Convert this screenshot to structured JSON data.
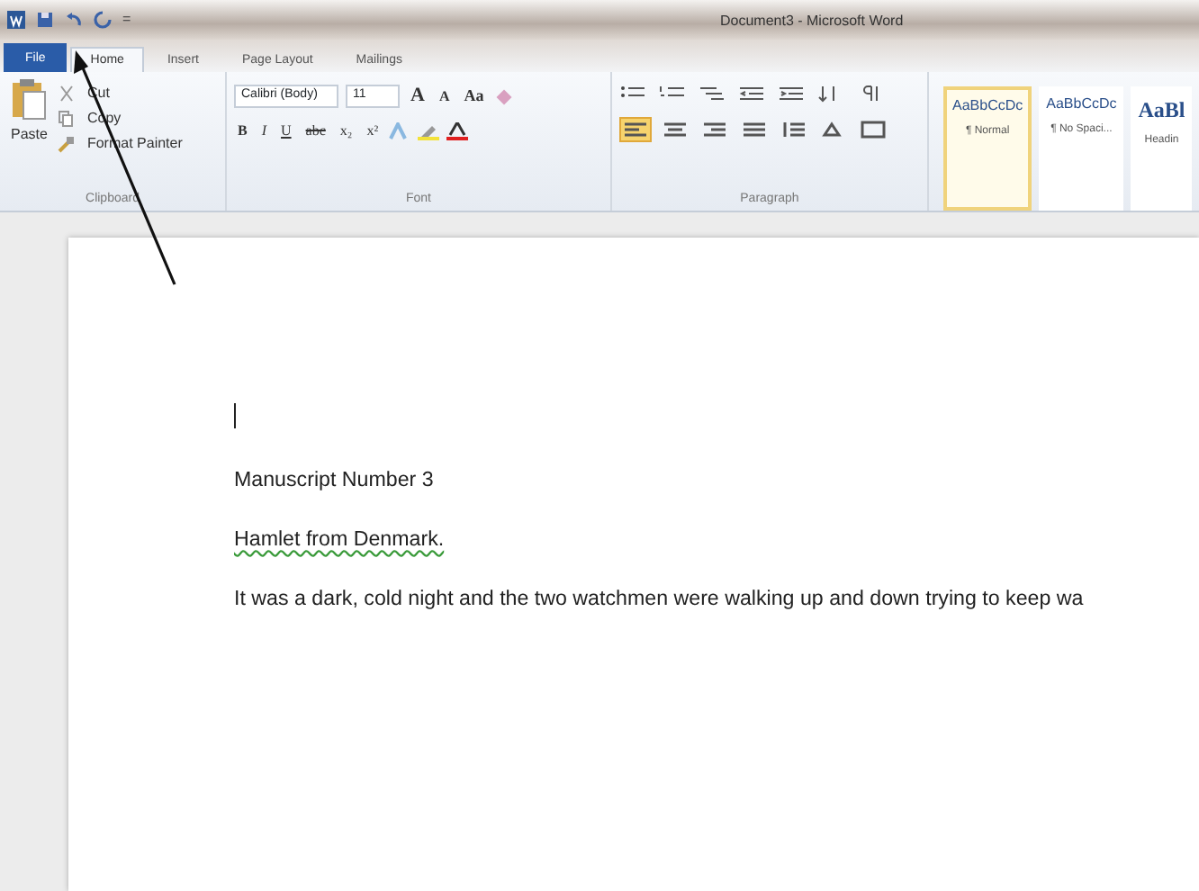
{
  "window": {
    "title": "Document3 - Microsoft Word",
    "quick_access": [
      "="
    ]
  },
  "tabs": [
    {
      "label": "File",
      "kind": "file",
      "selected": false
    },
    {
      "label": "Home",
      "kind": "tab",
      "selected": true
    },
    {
      "label": "Insert",
      "kind": "tab",
      "selected": false
    },
    {
      "label": "Page Layout",
      "kind": "tab",
      "selected": false
    },
    {
      "label": "Mailings",
      "kind": "tab",
      "selected": false
    }
  ],
  "clipboard": {
    "label": "Clipboard",
    "paste": "Paste",
    "items": [
      "Cut",
      "Copy",
      "Format Painter"
    ]
  },
  "font": {
    "label": "Font",
    "font_name": "Calibri (Body)",
    "font_size": "11",
    "row1": [
      "A",
      "A",
      "Aa"
    ],
    "row2": [
      "B",
      "I",
      "U",
      "abc",
      "x₂",
      "x²"
    ]
  },
  "paragraph": {
    "label": "Paragraph",
    "row2": [
      {
        "selected": true
      },
      {
        "selected": false
      },
      {
        "selected": false
      },
      {
        "selected": false
      },
      {
        "selected": false
      },
      {
        "selected": false
      },
      {
        "selected": false
      }
    ]
  },
  "styles": [
    {
      "sample": "AaBbCcDc",
      "name": "¶ Normal",
      "selected": true
    },
    {
      "sample": "AaBbCcDc",
      "name": "¶ No Spaci...",
      "selected": false
    },
    {
      "sample": "AaBl",
      "name": "Headin",
      "selected": false
    }
  ],
  "document": {
    "cursor": true,
    "paragraphs": [
      {
        "text": "Manuscript Number 3",
        "grammar_error": false
      },
      {
        "text": "Hamlet from Denmark.",
        "grammar_error": true
      },
      {
        "text": "It was a dark, cold night and the two watchmen were walking up and down trying to keep wa",
        "grammar_error": false
      }
    ]
  },
  "annotation": {
    "kind": "arrow"
  }
}
